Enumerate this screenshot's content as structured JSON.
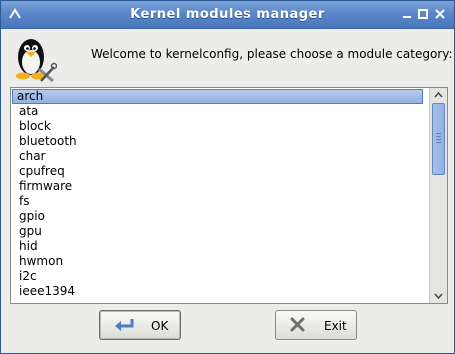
{
  "window": {
    "title": "Kernel modules manager",
    "title_buttons": [
      "minimize",
      "maximize",
      "close"
    ]
  },
  "header": {
    "welcome": "Welcome to kernelconfig, please choose a module category:"
  },
  "list": {
    "selected": "arch",
    "items": [
      "arch",
      "ata",
      "block",
      "bluetooth",
      "char",
      "cpufreq",
      "firmware",
      "fs",
      "gpio",
      "gpu",
      "hid",
      "hwmon",
      "i2c",
      "ieee1394"
    ]
  },
  "buttons": {
    "ok": "OK",
    "exit": "Exit"
  },
  "colors": {
    "titlebar": "#5b87c8",
    "selection": "#92b2e3"
  }
}
